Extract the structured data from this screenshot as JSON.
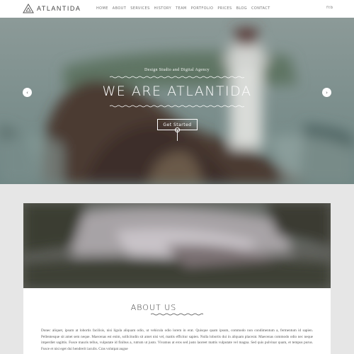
{
  "brand": {
    "name": "ATLANTIDA"
  },
  "nav": {
    "items": [
      "HOME",
      "ABOUT",
      "SERVICES",
      "HISTORY",
      "TEAM",
      "PORTFOLIO",
      "PRICES",
      "BLOG",
      "CONTACT"
    ]
  },
  "social": {
    "icons": [
      "facebook-icon",
      "twitter-icon",
      "behance-icon"
    ],
    "glyphs": [
      "f",
      "t",
      "b"
    ]
  },
  "hero": {
    "subtitle": "Design Studio and Digital Agency",
    "title": "WE ARE ATLANTIDA",
    "cta_label": "Get Started",
    "prev_glyph": "‹",
    "next_glyph": "›"
  },
  "about": {
    "title": "ABOUT US",
    "text": "Donec aliquet, ipsum at lobortis facilisis, nisi ligula aliquam odio, ut vehicula odio lorem in erat. Quisque quam ipsum, commodo non condimentum a, fermentum id sapien. Pellentesque sit amet sem neque. Maecenas est enim, sollicitudin sit amet nisi vel, mattis efficitur sapien. Nulla lobortis dui in aliquam placerat. Maecenas commodo odio nec neque imperdiet sagittis. Fusce mauris tellus, vulputate id finibus a, rutrum ut justo. Vivamus at eros sed justo laoreet mattis vulputate vel magna. Sed quis pulvinar quam, et tempus purus. Fusce et nisi eget dui hendrerit iaculis. Cras volutpat augue"
  },
  "colors": {
    "header_bg": "#ffffff",
    "page_bg": "#e6e6e6",
    "hero_sea": "#6f8685",
    "text_dark": "#333333"
  }
}
